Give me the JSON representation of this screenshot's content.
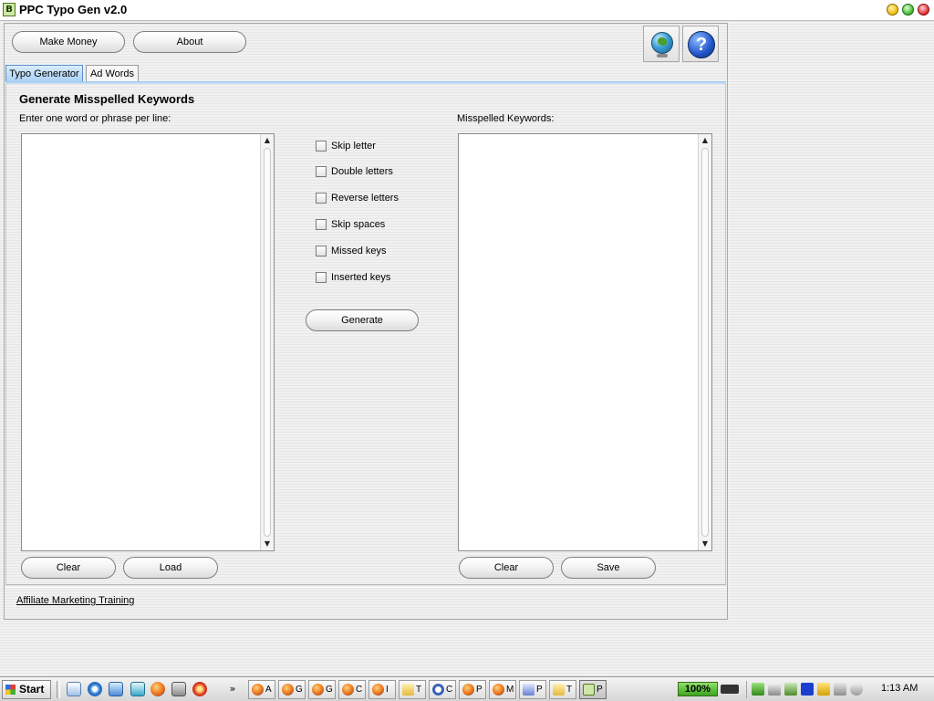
{
  "window": {
    "title": "PPC Typo Gen v2.0",
    "app_icon_glyph": "B"
  },
  "toolbar": {
    "make_money_label": "Make Money",
    "about_label": "About",
    "icons": [
      "globe-icon",
      "help-icon"
    ],
    "help_glyph": "?"
  },
  "tabs": [
    {
      "label": "Typo Generator",
      "active": true
    },
    {
      "label": "Ad Words",
      "active": false
    }
  ],
  "generator": {
    "heading": "Generate Misspelled Keywords",
    "input_label": "Enter one word or phrase per line:",
    "output_label": "Misspelled Keywords:",
    "input_value": "",
    "output_value": "",
    "options": [
      {
        "label": "Skip letter",
        "checked": false
      },
      {
        "label": "Double letters",
        "checked": false
      },
      {
        "label": "Reverse letters",
        "checked": false
      },
      {
        "label": "Skip spaces",
        "checked": false
      },
      {
        "label": "Missed keys",
        "checked": false
      },
      {
        "label": "Inserted keys",
        "checked": false
      }
    ],
    "generate_label": "Generate",
    "input_clear_label": "Clear",
    "input_load_label": "Load",
    "output_clear_label": "Clear",
    "output_save_label": "Save",
    "scroll_up_glyph": "▲",
    "scroll_down_glyph": "▼"
  },
  "footer": {
    "link_label": "Affiliate Marketing Training"
  },
  "taskbar": {
    "start_label": "Start",
    "overflow_glyph": "»",
    "tasks": [
      {
        "letter": "A",
        "icon": "firefox-icon"
      },
      {
        "letter": "G",
        "icon": "firefox-icon"
      },
      {
        "letter": "G",
        "icon": "firefox-icon"
      },
      {
        "letter": "C",
        "icon": "firefox-icon"
      },
      {
        "letter": "I",
        "icon": "firefox-icon"
      },
      {
        "letter": "T",
        "icon": "folder-icon"
      },
      {
        "letter": "C",
        "icon": "app-c-icon"
      },
      {
        "letter": "P",
        "icon": "firefox-icon"
      },
      {
        "letter": "M",
        "icon": "firefox-icon"
      },
      {
        "letter": "P",
        "icon": "pdf-icon"
      },
      {
        "letter": "T",
        "icon": "folder-icon"
      },
      {
        "letter": "P",
        "icon": "ppc-typo-gen-icon",
        "active": true
      }
    ],
    "battery_label": "100%",
    "clock": "1:13 AM"
  },
  "colors": {
    "tab_active": "#a9d0f5",
    "battery": "#3aa51c"
  }
}
